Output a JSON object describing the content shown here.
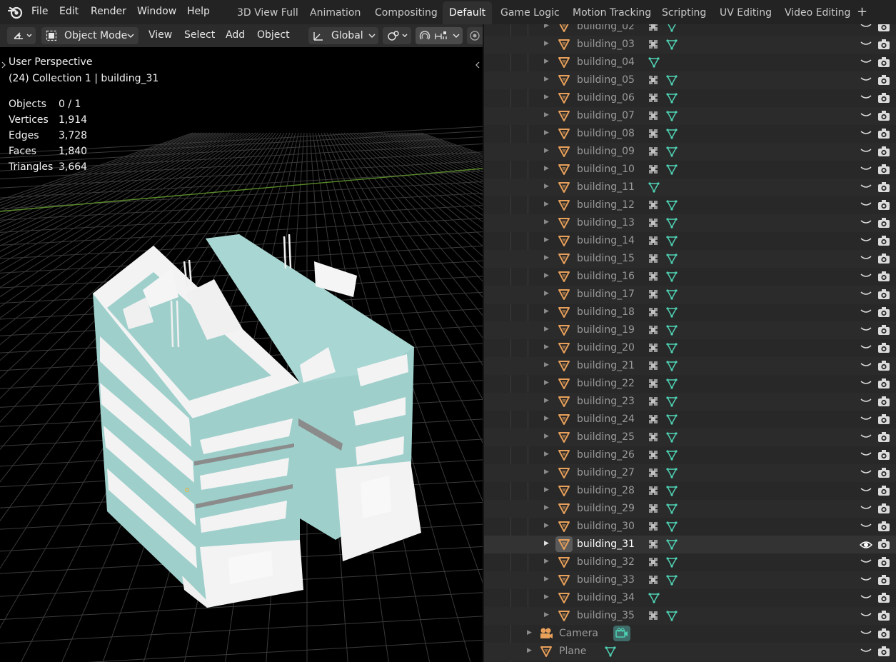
{
  "menubar": {
    "items": [
      "File",
      "Edit",
      "Render",
      "Window",
      "Help"
    ]
  },
  "workspaces": {
    "tabs": [
      "3D View Full",
      "Animation",
      "Compositing",
      "Default",
      "Game Logic",
      "Motion Tracking",
      "Scripting",
      "UV Editing",
      "Video Editing"
    ],
    "active": "Default",
    "add_label": "+"
  },
  "viewport_header": {
    "mode": "Object Mode",
    "menus": [
      "View",
      "Select",
      "Add",
      "Object"
    ],
    "orientation": "Global"
  },
  "viewport_overlay": {
    "perspective": "User Perspective",
    "context": "(24) Collection 1 | building_31",
    "stats": [
      {
        "label": "Objects",
        "value": "0 / 1"
      },
      {
        "label": "Vertices",
        "value": "1,914"
      },
      {
        "label": "Edges",
        "value": "3,728"
      },
      {
        "label": "Faces",
        "value": "1,840"
      },
      {
        "label": "Triangles",
        "value": "3,664"
      }
    ]
  },
  "outliner": {
    "selected": "building_31",
    "rows": [
      {
        "name": "building_02",
        "modifier": true
      },
      {
        "name": "building_03",
        "modifier": true
      },
      {
        "name": "building_04",
        "modifier": false
      },
      {
        "name": "building_05",
        "modifier": true
      },
      {
        "name": "building_06",
        "modifier": true
      },
      {
        "name": "building_07",
        "modifier": true
      },
      {
        "name": "building_08",
        "modifier": true
      },
      {
        "name": "building_09",
        "modifier": true
      },
      {
        "name": "building_10",
        "modifier": true
      },
      {
        "name": "building_11",
        "modifier": false
      },
      {
        "name": "building_12",
        "modifier": true
      },
      {
        "name": "building_13",
        "modifier": true
      },
      {
        "name": "building_14",
        "modifier": true
      },
      {
        "name": "building_15",
        "modifier": true
      },
      {
        "name": "building_16",
        "modifier": true
      },
      {
        "name": "building_17",
        "modifier": true
      },
      {
        "name": "building_18",
        "modifier": true
      },
      {
        "name": "building_19",
        "modifier": true
      },
      {
        "name": "building_20",
        "modifier": true
      },
      {
        "name": "building_21",
        "modifier": true
      },
      {
        "name": "building_22",
        "modifier": true
      },
      {
        "name": "building_23",
        "modifier": true
      },
      {
        "name": "building_24",
        "modifier": true
      },
      {
        "name": "building_25",
        "modifier": true
      },
      {
        "name": "building_26",
        "modifier": true
      },
      {
        "name": "building_27",
        "modifier": true
      },
      {
        "name": "building_28",
        "modifier": true
      },
      {
        "name": "building_29",
        "modifier": true
      },
      {
        "name": "building_30",
        "modifier": true
      },
      {
        "name": "building_31",
        "modifier": true
      },
      {
        "name": "building_32",
        "modifier": true
      },
      {
        "name": "building_33",
        "modifier": true
      },
      {
        "name": "building_34",
        "modifier": false
      },
      {
        "name": "building_35",
        "modifier": true
      }
    ],
    "extra_rows": [
      {
        "name": "Camera",
        "type": "camera"
      },
      {
        "name": "Plane",
        "type": "mesh"
      }
    ]
  },
  "colors": {
    "accent_active_tab": "#303030",
    "mesh_icon": "#e8a05a",
    "data_icon": "#4fd1b3",
    "building_face": "#9ecfcb",
    "building_trim": "#f2f2f2"
  },
  "icons": {
    "object": "mesh-triangle-icon",
    "modifier": "modifier-grid-icon",
    "mesh_data": "mesh-data-icon",
    "visibility": "eye-icon",
    "render": "camera-render-icon"
  }
}
